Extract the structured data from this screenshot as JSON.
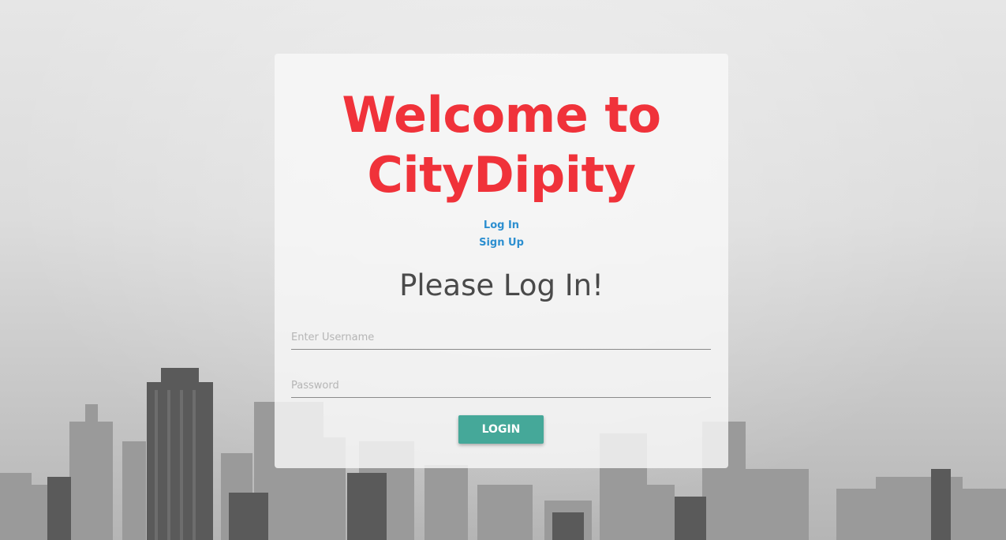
{
  "colors": {
    "accent": "#f0323a",
    "link": "#2d8fd0",
    "button": "#45a899"
  },
  "header": {
    "title_line1": "Welcome to",
    "title_line2": "CityDipity"
  },
  "nav": {
    "login_link": "Log In",
    "signup_link": "Sign Up"
  },
  "form": {
    "heading": "Please Log In!",
    "username_placeholder": "Enter Username",
    "username_value": "",
    "password_placeholder": "Password",
    "password_value": "",
    "submit_label": "LOGIN"
  }
}
